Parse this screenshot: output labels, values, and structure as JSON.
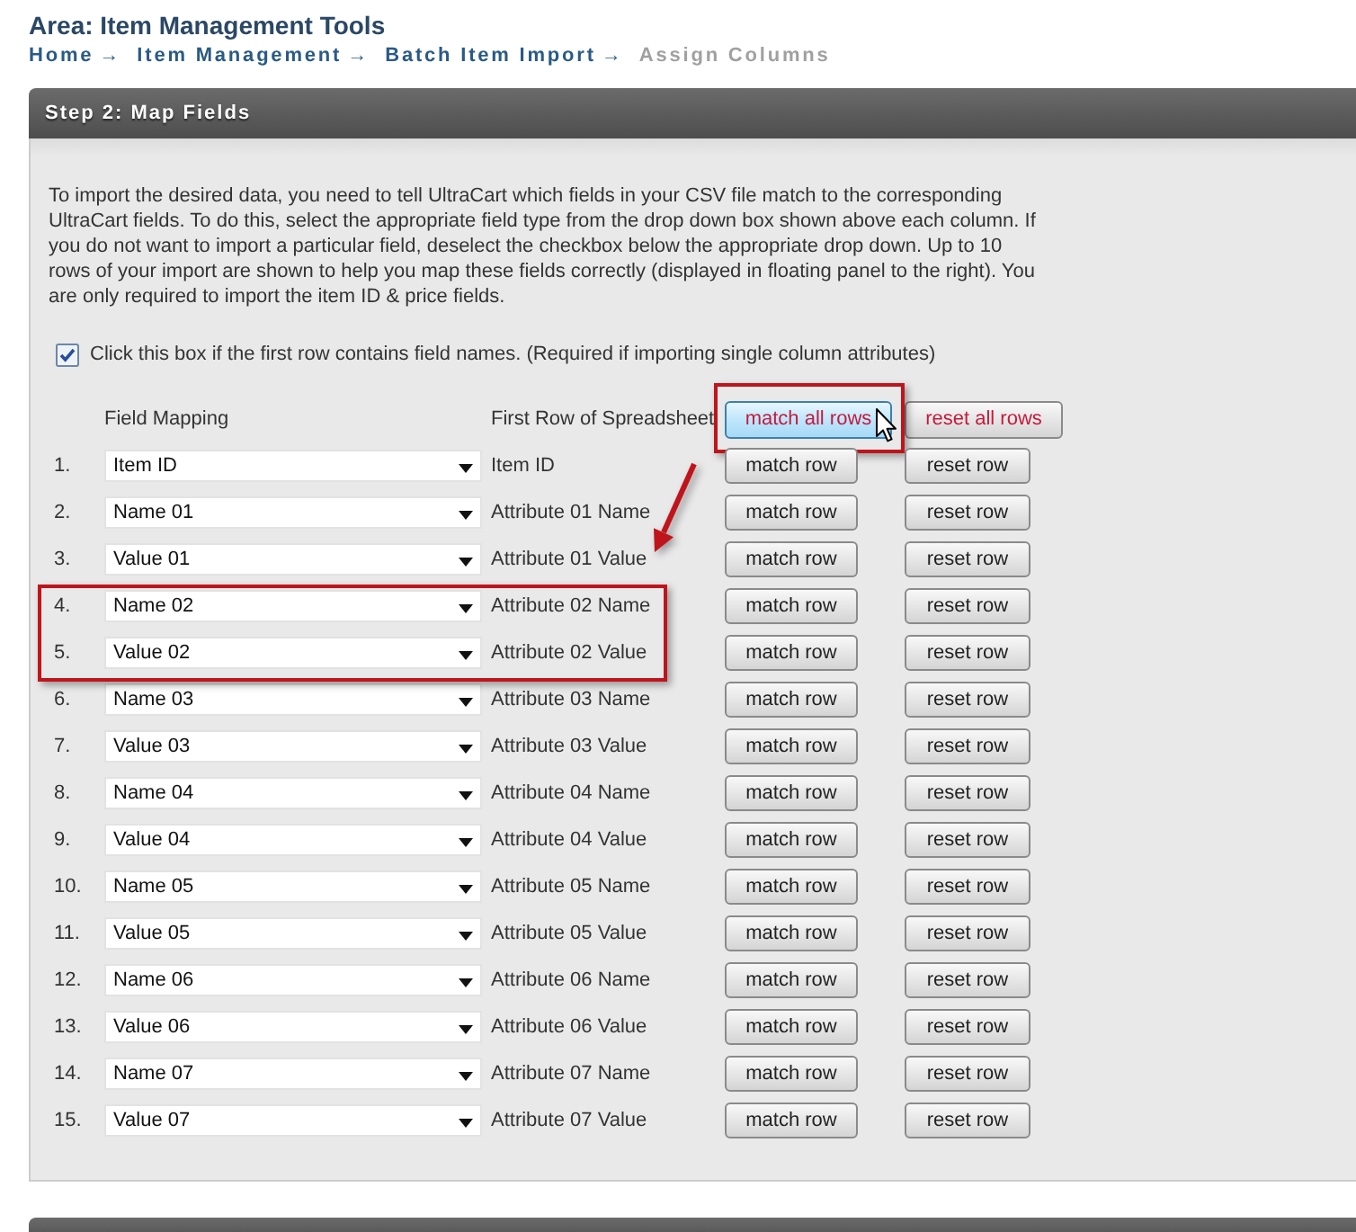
{
  "area_title": "Area: Item Management Tools",
  "breadcrumb": [
    {
      "label": "Home",
      "separator": "→",
      "current": false
    },
    {
      "label": "Item Management",
      "separator": "→",
      "current": false
    },
    {
      "label": "Batch Item Import",
      "separator": "→",
      "current": false
    },
    {
      "label": "Assign Columns",
      "current": true
    }
  ],
  "panel": {
    "title": "Step 2: Map Fields",
    "instructions": "To import the desired data, you need to tell UltraCart which fields in your CSV file match to the corresponding UltraCart fields. To do this, select the appropriate field type from the drop down box shown above each column. If you do not want to import a particular field, deselect the checkbox below the appropriate drop down. Up to 10 rows of your import are shown to help you map these fields correctly (displayed in floating panel to the right). You are only required to import the item ID & price fields.",
    "first_row_checkbox": {
      "label": "Click this box if the first row contains field names. (Required if importing single column attributes)",
      "checked": true
    },
    "columns": {
      "mapping": "Field Mapping",
      "first_row": "First Row of Spreadsheet"
    },
    "match_all_button": {
      "label": "match all rows",
      "hovered": true,
      "highlighted": true
    },
    "reset_all_button": {
      "label": "reset all rows"
    },
    "rows": [
      {
        "number": "1.",
        "mapping": "Item ID",
        "first_row_value": "Item ID",
        "match_button": "match row",
        "reset_button": "reset row",
        "highlighted": false
      },
      {
        "number": "2.",
        "mapping": "Name 01",
        "first_row_value": "Attribute 01 Name",
        "match_button": "match row",
        "reset_button": "reset row",
        "highlighted": false
      },
      {
        "number": "3.",
        "mapping": "Value 01",
        "first_row_value": "Attribute 01 Value",
        "match_button": "match row",
        "reset_button": "reset row",
        "highlighted": false
      },
      {
        "number": "4.",
        "mapping": "Name 02",
        "first_row_value": "Attribute 02 Name",
        "match_button": "match row",
        "reset_button": "reset row",
        "highlighted": true
      },
      {
        "number": "5.",
        "mapping": "Value 02",
        "first_row_value": "Attribute 02 Value",
        "match_button": "match row",
        "reset_button": "reset row",
        "highlighted": true
      },
      {
        "number": "6.",
        "mapping": "Name 03",
        "first_row_value": "Attribute 03 Name",
        "match_button": "match row",
        "reset_button": "reset row",
        "highlighted": false
      },
      {
        "number": "7.",
        "mapping": "Value 03",
        "first_row_value": "Attribute 03 Value",
        "match_button": "match row",
        "reset_button": "reset row",
        "highlighted": false
      },
      {
        "number": "8.",
        "mapping": "Name 04",
        "first_row_value": "Attribute 04 Name",
        "match_button": "match row",
        "reset_button": "reset row",
        "highlighted": false
      },
      {
        "number": "9.",
        "mapping": "Value 04",
        "first_row_value": "Attribute 04 Value",
        "match_button": "match row",
        "reset_button": "reset row",
        "highlighted": false
      },
      {
        "number": "10.",
        "mapping": "Name 05",
        "first_row_value": "Attribute 05 Name",
        "match_button": "match row",
        "reset_button": "reset row",
        "highlighted": false
      },
      {
        "number": "11.",
        "mapping": "Value 05",
        "first_row_value": "Attribute 05 Value",
        "match_button": "match row",
        "reset_button": "reset row",
        "highlighted": false
      },
      {
        "number": "12.",
        "mapping": "Name 06",
        "first_row_value": "Attribute 06 Name",
        "match_button": "match row",
        "reset_button": "reset row",
        "highlighted": false
      },
      {
        "number": "13.",
        "mapping": "Value 06",
        "first_row_value": "Attribute 06 Value",
        "match_button": "match row",
        "reset_button": "reset row",
        "highlighted": false
      },
      {
        "number": "14.",
        "mapping": "Name 07",
        "first_row_value": "Attribute 07 Name",
        "match_button": "match row",
        "reset_button": "reset row",
        "highlighted": false
      },
      {
        "number": "15.",
        "mapping": "Value 07",
        "first_row_value": "Attribute 07 Value",
        "match_button": "match row",
        "reset_button": "reset row",
        "highlighted": false
      }
    ]
  }
}
